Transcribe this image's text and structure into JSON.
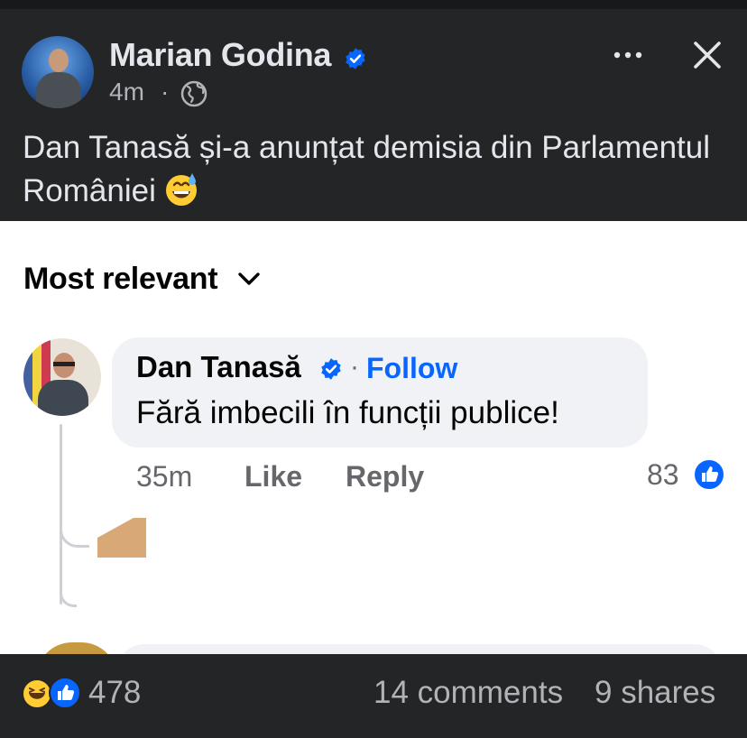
{
  "post": {
    "author": "Marian Godina",
    "time": "4m",
    "separator": "·",
    "privacy_icon": "globe-icon",
    "text": "Dan Tanasă și-a anunțat demisia din Parlamentul României",
    "emoji": "grinning-face-with-sweat"
  },
  "comments": {
    "sort_label": "Most relevant",
    "items": [
      {
        "author": "Dan Tanasă",
        "follow_label": "Follow",
        "separator": "·",
        "text": "Fără imbecili în funcții publice!",
        "time": "35m",
        "like_label": "Like",
        "reply_label": "Reply",
        "reaction_count": "83"
      }
    ]
  },
  "footer": {
    "reactions_total": "478",
    "comments": "14 comments",
    "shares": "9 shares"
  },
  "colors": {
    "dark_bg": "#242526",
    "accent_blue": "#0866ff",
    "bubble_bg": "#f0f2f5"
  }
}
